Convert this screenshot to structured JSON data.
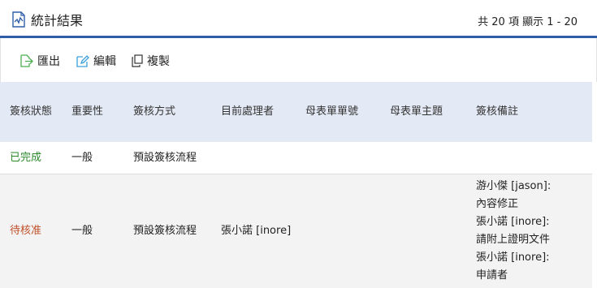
{
  "header": {
    "title": "統計結果",
    "paging": "共 20 項 顯示 1 - 20"
  },
  "toolbar": {
    "export_label": "匯出",
    "edit_label": "編輯",
    "copy_label": "複製"
  },
  "table": {
    "columns": [
      "簽核狀態",
      "重要性",
      "簽核方式",
      "目前處理者",
      "母表單單號",
      "母表單主題",
      "簽核備註"
    ],
    "rows": [
      {
        "status": "已完成",
        "importance": "一般",
        "method": "預設簽核流程",
        "handler": "",
        "parent_no": "",
        "parent_subject": "",
        "remarks": []
      },
      {
        "status": "待核准",
        "importance": "一般",
        "method": "預設簽核流程",
        "handler": "張小諾 [inore]",
        "parent_no": "",
        "parent_subject": "",
        "remarks": [
          "游小傑 [jason]:",
          "內容修正",
          "張小諾 [inore]:",
          "請附上證明文件",
          "張小諾 [inore]:",
          "申請者"
        ]
      }
    ]
  },
  "colors": {
    "accent": "#2e5ea8",
    "header_bg": "#e4eaf5",
    "status_done": "#2a8a2a",
    "status_pending": "#c0502a",
    "icon_green": "#4caf50",
    "icon_blue": "#3aa0d8"
  },
  "icons": {
    "title": "chart-document-icon",
    "export": "export-icon",
    "edit": "edit-icon",
    "copy": "copy-icon"
  }
}
